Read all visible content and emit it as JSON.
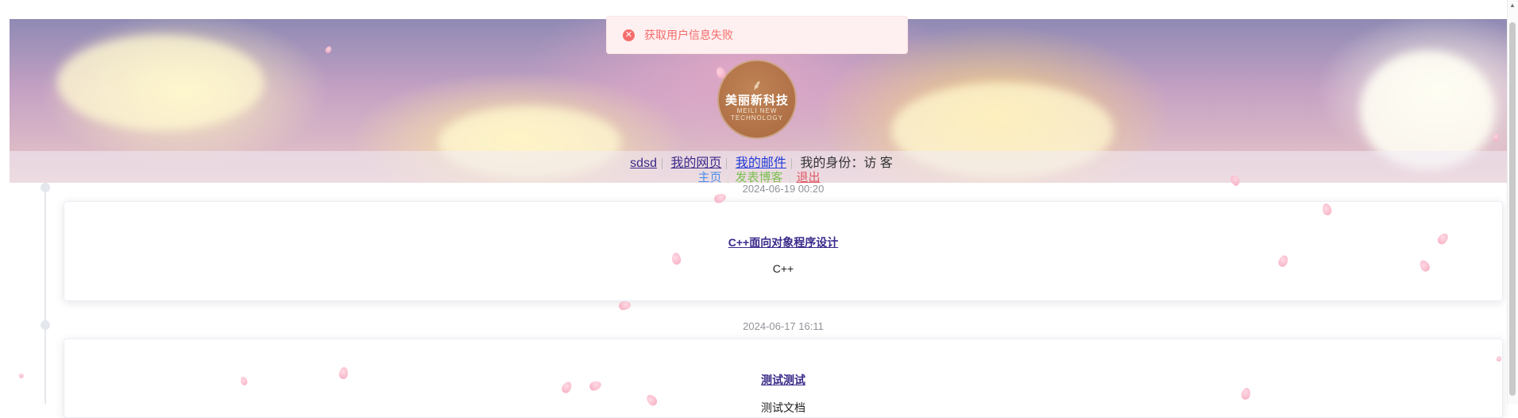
{
  "toast": {
    "message": "获取用户信息失败",
    "type": "error",
    "color": "#f56c6c"
  },
  "logo": {
    "chinese": "美丽新科技",
    "english_line1": "MEILI NEW",
    "english_line2": "TECHNOLOGY"
  },
  "nav": {
    "user": "sdsd",
    "my_page": "我的网页",
    "my_email": "我的邮件",
    "identity": "我的身份：访 客",
    "home": "主页",
    "publish": "发表博客",
    "logout": "退出"
  },
  "posts": [
    {
      "date": "2024-06-19 00:20",
      "title": "C++面向对象程序设计",
      "summary": "C++"
    },
    {
      "date": "2024-06-17 16:11",
      "title": "测试测试",
      "summary": "测试文档"
    }
  ],
  "colors": {
    "accent_link": "#3b2a8a",
    "email_link": "#1f3ad6",
    "home": "#4a8ee8",
    "publish": "#7ac04f",
    "logout": "#e05a66"
  }
}
